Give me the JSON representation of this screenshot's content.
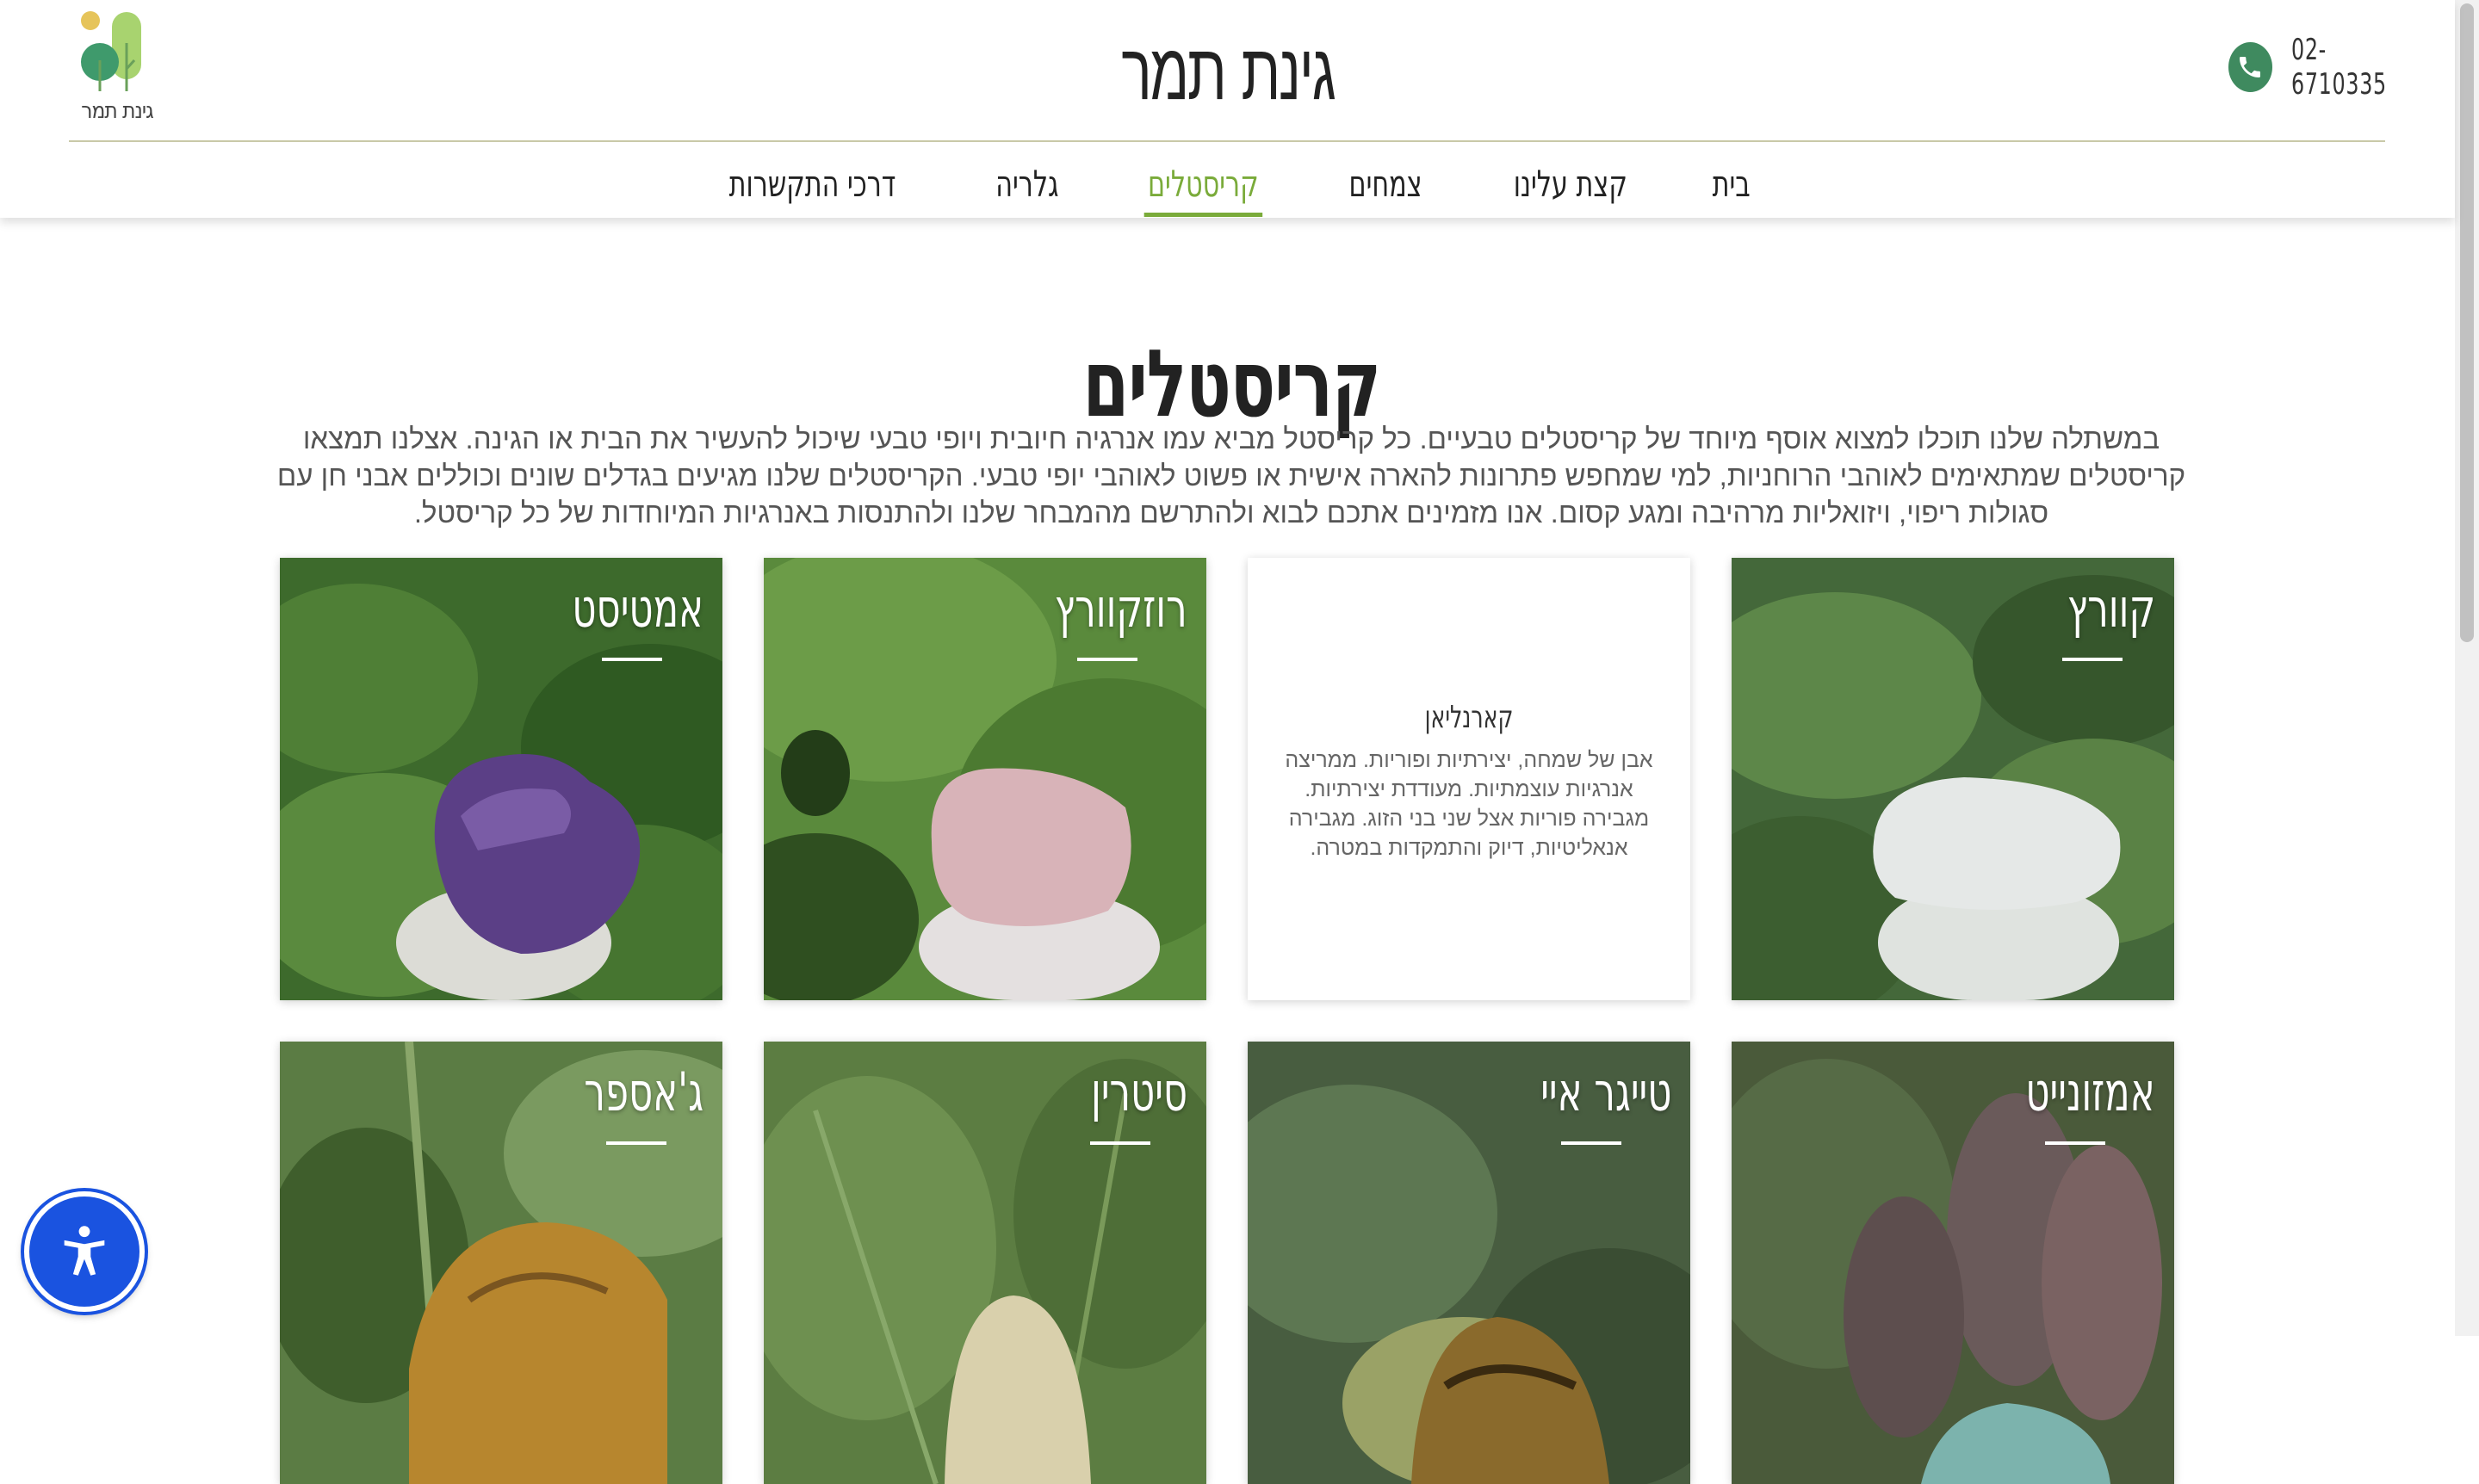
{
  "site": {
    "title": "גינת תמר",
    "logo_text": "גינת תמר",
    "phone": "02-6710335"
  },
  "nav": {
    "items": [
      {
        "label": "בית",
        "active": false
      },
      {
        "label": "קצת עלינו",
        "active": false
      },
      {
        "label": "צמחים",
        "active": false
      },
      {
        "label": "קריסטלים",
        "active": true
      },
      {
        "label": "גלריה",
        "active": false
      },
      {
        "label": "דרכי התקשרות",
        "active": false
      }
    ]
  },
  "page": {
    "heading": "קריסטלים",
    "intro": "במשתלה שלנו תוכלו למצוא אוסף מיוחד של קריסטלים טבעיים. כל קריסטל מביא עמו אנרגיה חיובית ויופי טבעי שיכול להעשיר את הבית או הגינה. אצלנו תמצאו קריסטלים שמתאימים לאוהבי הרוחניות, למי שמחפש פתרונות להארה אישית או פשוט לאוהבי יופי טבעי. הקריסטלים שלנו מגיעים בגדלים שונים וכוללים אבני חן עם סגולות ריפוי, ויזואליות מרהיבה ומגע קסום. אנו מזמינים אתכם לבוא ולהתרשם מהמבחר שלנו ולהתנסות באנרגיות המיוחדות של כל קריסטל."
  },
  "crystals": [
    {
      "name": "קוורץ",
      "colors": {
        "bg": "#4a6b3a",
        "stone": "#dfe3e2"
      }
    },
    {
      "name": "קארנליאן",
      "hover": true,
      "description": "אבן של שמחה, יצירתיות ופוריות. ממריצה אנרגיות עוצמתיות. מעודדת יצירתיות. מגבירה פוריות אצל שני בני הזוג. מגבירה אנאליטיות, דיוק והתמקדות במטרה."
    },
    {
      "name": "רוזקוורץ",
      "colors": {
        "bg": "#5d8a3f",
        "stone": "#d9b8b9"
      }
    },
    {
      "name": "אמטיסט",
      "colors": {
        "bg": "#3f6b2e",
        "stone": "#6a4a8c"
      }
    },
    {
      "name": "אמזונייט",
      "colors": {
        "bg": "#4d5a3e",
        "stone": "#7fb4ae"
      }
    },
    {
      "name": "טייגר איי",
      "colors": {
        "bg": "#4a5e42",
        "stone": "#8b6a2c"
      }
    },
    {
      "name": "סיטרין",
      "colors": {
        "bg": "#5a7a3e",
        "stone": "#d8cfa7"
      }
    },
    {
      "name": "ג'אספר",
      "colors": {
        "bg": "#5d7a44",
        "stone": "#b8862d"
      }
    }
  ]
}
